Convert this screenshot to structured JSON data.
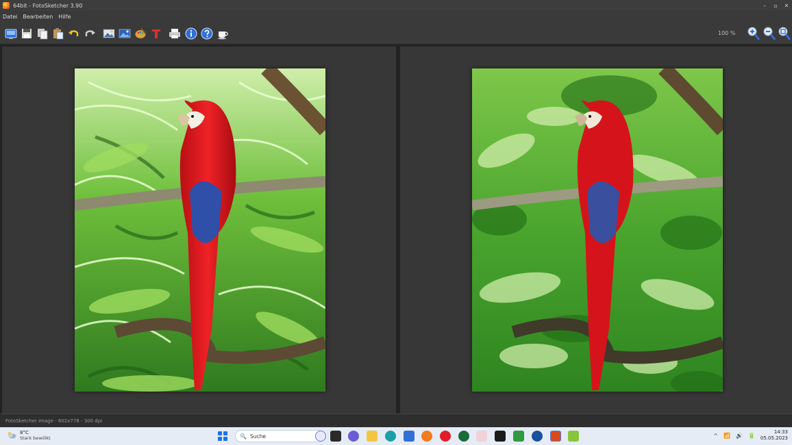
{
  "window": {
    "title": "64bit - FotoSketcher 3.90",
    "controls": {
      "minimize": "–",
      "restore": "▫",
      "close": "✕"
    }
  },
  "menu": {
    "items": [
      "Datei",
      "Bearbeiten",
      "Hilfe"
    ]
  },
  "toolbar": {
    "buttons": [
      "open-icon",
      "save-icon",
      "copy-icon",
      "paste-icon",
      "undo-icon",
      "redo-icon",
      "original-image-icon",
      "result-image-icon",
      "palette-icon",
      "text-icon",
      "print-icon",
      "info-icon",
      "help-icon",
      "coffee-icon"
    ],
    "zoom_level": "100 %",
    "zoom_buttons": [
      "zoom-in-icon",
      "zoom-out-icon",
      "zoom-fit-icon"
    ]
  },
  "status": {
    "text": "FotoSketcher image - 602x778 - 300 dpi"
  },
  "taskbar": {
    "weather_temp": "8°C",
    "weather_condition": "Stark bewölkt",
    "search_placeholder": "Suche",
    "search_glyph": "🔍",
    "time": "14:33",
    "date": "05.05.2023",
    "tray_chevron": "^",
    "tray_icons": [
      "📶",
      "🔊",
      "🔋"
    ]
  },
  "colors": {
    "accent": "#1a73e8",
    "parrot_red": "#d4141a",
    "foliage": "#3f9a2c"
  }
}
